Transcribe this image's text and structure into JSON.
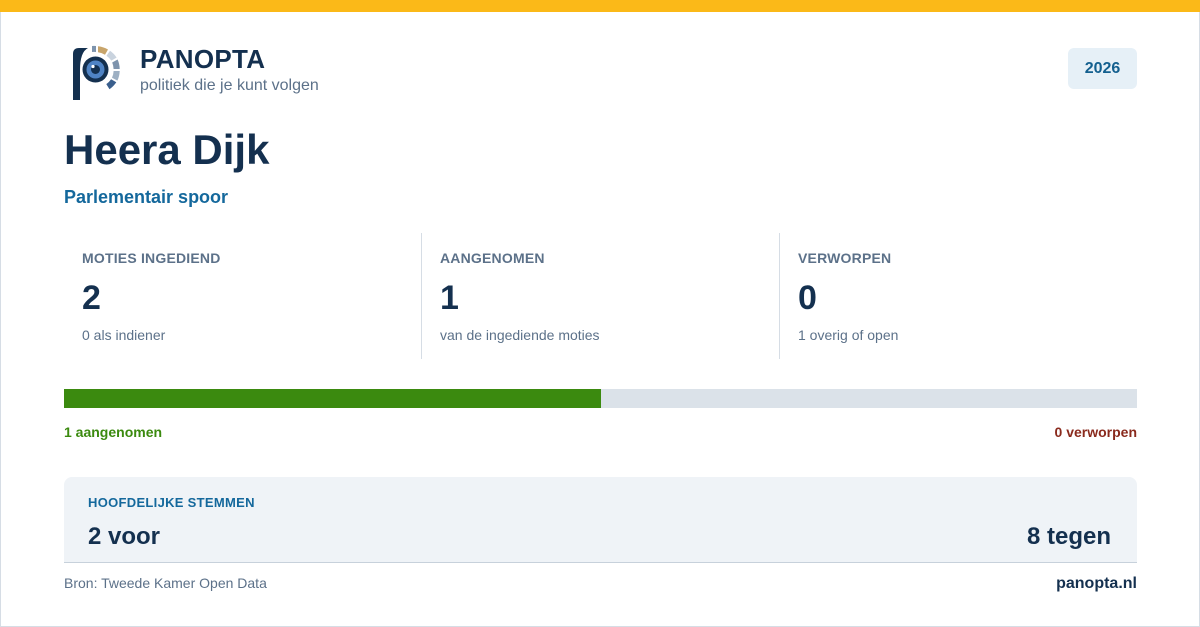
{
  "brand": {
    "name": "PANOPTA",
    "tagline": "politiek die je kunt volgen",
    "logo_icon": "panopta-eye-logo-icon"
  },
  "year": "2026",
  "person": {
    "name": "Heera Dijk",
    "track": "Parlementair spoor"
  },
  "stats": [
    {
      "label": "MOTIES INGEDIEND",
      "value": "2",
      "sub": "0 als indiener"
    },
    {
      "label": "AANGENOMEN",
      "value": "1",
      "sub": "van de ingediende moties"
    },
    {
      "label": "VERWORPEN",
      "value": "0",
      "sub": "1 overig of open"
    }
  ],
  "progress": {
    "adopted_fraction": 0.5,
    "left_label": "1 aangenomen",
    "right_label": "0 verworpen"
  },
  "votes": {
    "title": "HOOFDELIJKE STEMMEN",
    "for": "2 voor",
    "against": "8 tegen"
  },
  "footer": {
    "source": "Bron: Tweede Kamer Open Data",
    "site": "panopta.nl"
  },
  "colors": {
    "accent_stripe": "#fbb918",
    "navy": "#14304f",
    "link_blue": "#14689c",
    "adopted_green": "#3b8a0f",
    "rejected_red": "#8a2a1d"
  }
}
